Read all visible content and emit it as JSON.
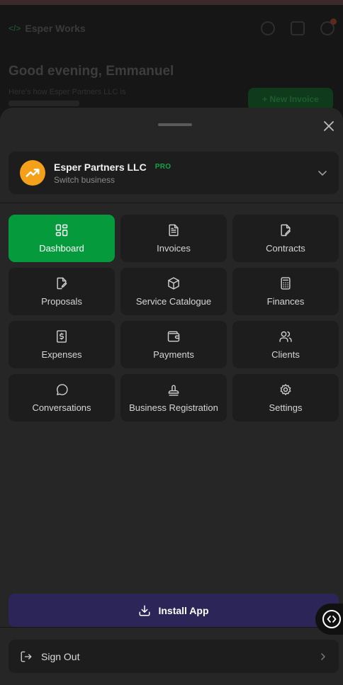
{
  "background": {
    "brand": "Esper Works",
    "greeting": "Good evening, Emmanuel",
    "subtitle": "Here's how Esper Partners LLC is",
    "action": "+ New Invoice"
  },
  "sheet": {
    "business": {
      "name": "Esper Partners LLC",
      "badge": "PRO",
      "switch_label": "Switch business"
    },
    "nav": [
      {
        "label": "Dashboard",
        "icon": "dashboard-icon",
        "active": true
      },
      {
        "label": "Invoices",
        "icon": "document-icon",
        "active": false
      },
      {
        "label": "Contracts",
        "icon": "contract-edit-icon",
        "active": false
      },
      {
        "label": "Proposals",
        "icon": "proposal-edit-icon",
        "active": false
      },
      {
        "label": "Service Catalogue",
        "icon": "package-icon",
        "active": false
      },
      {
        "label": "Finances",
        "icon": "calculator-icon",
        "active": false
      },
      {
        "label": "Expenses",
        "icon": "receipt-dollar-icon",
        "active": false
      },
      {
        "label": "Payments",
        "icon": "wallet-icon",
        "active": false
      },
      {
        "label": "Clients",
        "icon": "users-icon",
        "active": false
      },
      {
        "label": "Conversations",
        "icon": "chat-bubble-icon",
        "active": false
      },
      {
        "label": "Business Registration",
        "icon": "stamp-icon",
        "active": false
      },
      {
        "label": "Settings",
        "icon": "gear-icon",
        "active": false
      }
    ],
    "install_label": "Install App",
    "signout_label": "Sign Out"
  },
  "colors": {
    "accent": "#059b3d",
    "badge": "#12a54a",
    "install_bg": "#2b2657",
    "avatar": "#f5a01a",
    "sheet_bg": "#262626",
    "tile_bg": "#1d1d1d"
  }
}
